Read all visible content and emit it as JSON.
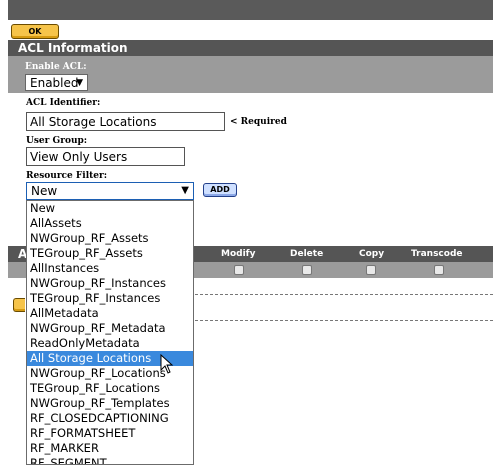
{
  "toolbar": {
    "ok_label": "OK"
  },
  "acl": {
    "header": "ACL Information",
    "enable_label": "Enable ACL:",
    "enable_value": "Enabled",
    "identifier_label": "ACL Identifier:",
    "identifier_value": "All Storage Locations",
    "required_text": "< Required",
    "user_group_label": "User Group:",
    "user_group_value": "View Only Users",
    "resource_filter_label": "Resource Filter:",
    "resource_filter_value": "New",
    "add_label": "ADD"
  },
  "permissions": {
    "header_fragment": "A",
    "columns": [
      "Modify",
      "Delete",
      "Copy",
      "Transcode"
    ]
  },
  "dropdown": {
    "options": [
      "New",
      "AllAssets",
      "NWGroup_RF_Assets",
      "TEGroup_RF_Assets",
      "AllInstances",
      "NWGroup_RF_Instances",
      "TEGroup_RF_Instances",
      "AllMetadata",
      "NWGroup_RF_Metadata",
      "ReadOnlyMetadata",
      "All Storage Locations",
      "NWGroup_RF_Locations",
      "TEGroup_RF_Locations",
      "NWGroup_RF_Templates",
      "RF_CLOSEDCAPTIONING",
      "RF_FORMATSHEET",
      "RF_MARKER",
      "RF_SEGMENT"
    ],
    "highlighted": "All Storage Locations"
  },
  "colors": {
    "button": "#f6c44a",
    "header": "#555555",
    "row": "#9b9b9b",
    "highlight": "#3a89dd"
  }
}
